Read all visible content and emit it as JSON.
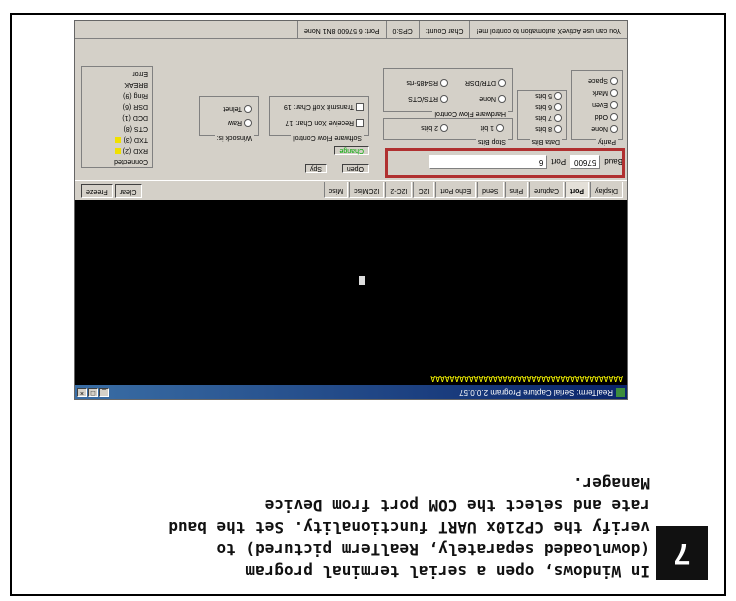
{
  "step": {
    "number": "7"
  },
  "caption": {
    "lines": [
      "In Windows, open a serial terminal program",
      "(downloaded separately, RealTerm pictured) to",
      "verify the CP210x UART functionality. Set the baud",
      "rate and select the COM port from Device",
      "Manager."
    ]
  },
  "realterm": {
    "title": "RealTerm: Serial Capture Program 2.0.0.57",
    "terminal_text": "AAAAAAAAAAAAAAAAAAAAAAAAAAAAAAAAAAAAAAAA",
    "tabs": [
      "Display",
      "Port",
      "Capture",
      "Pins",
      "Send",
      "Echo Port",
      "I2C",
      "I2C-2",
      "I2CMisc",
      "Misc"
    ],
    "active_tab": "Port",
    "clear_button": "Clear",
    "freeze_button": "Freeze",
    "port_label": "Port",
    "baud_label": "Baud",
    "baud_value": "57600",
    "port_value": "6",
    "open_button": "Open",
    "spy_label": "Spy",
    "change_button": "Change",
    "parity_title": "Parity",
    "parity_options": [
      "None",
      "Odd",
      "Even",
      "Mark",
      "Space"
    ],
    "databits_title": "Data Bits",
    "databits_options": [
      "8 bits",
      "7 bits",
      "6 bits",
      "5 bits"
    ],
    "stopbits_title": "Stop Bits",
    "stopbits_options": [
      "1 bit",
      "2 bits"
    ],
    "hwflow_title": "Hardware Flow Control",
    "hwflow_options": [
      "None",
      "RTS/CTS",
      "DTR/DSR",
      "RS485-rts"
    ],
    "swflow_title": "Software Flow Control",
    "swflow_rx": "Receive Xon Char: 17",
    "swflow_tx": "Transmit Xoff Char: 19",
    "winsock_title": "Winsock is:",
    "winsock_options": [
      "Raw",
      "Telnet"
    ],
    "status_items": [
      "Connected",
      "RXD (2)",
      "TXD (3)",
      "CTS (8)",
      "DCD (1)",
      "DSR (6)",
      "Ring (9)",
      "BREAK",
      "Error"
    ],
    "statusbar": [
      "You can use ActiveX automation to control me!",
      "Char Count:",
      "CPS:0",
      "Port: 6 57600 8N1 None"
    ],
    "colors": {
      "led": "#f0e000",
      "terminal_bg": "#000000",
      "terminal_text": "#f0e000",
      "highlight": "#b03030"
    }
  }
}
